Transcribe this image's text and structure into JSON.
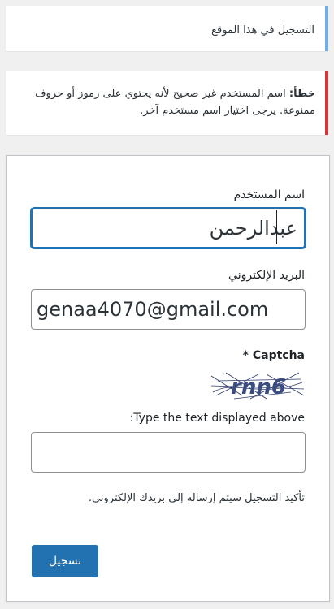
{
  "info_notice": {
    "text": "التسجيل في هذا الموقع"
  },
  "error_notice": {
    "prefix": "خطأ:",
    "message": " اسم المستخدم غير صحيح لأنه يحتوي على رموز أو حروف ممنوعة. يرجى اختيار اسم مستخدم آخر."
  },
  "form": {
    "username_label": "اسم المستخدم",
    "username_value": "عبدالرحمن",
    "email_label": "البريد الإلكتروني",
    "email_value": "genaa4070@gmail.com",
    "captcha_title": "* Captcha",
    "captcha_image_text": "rnn6",
    "captcha_prompt": ":Type the text displayed above",
    "captcha_value": "",
    "confirmation_note": "تأكيد التسجيل سيتم إرساله إلى بريدك الإلكتروني.",
    "submit_label": "تسجيل"
  },
  "colors": {
    "accent": "#2271b1",
    "error": "#d63638",
    "info": "#72aee6"
  }
}
